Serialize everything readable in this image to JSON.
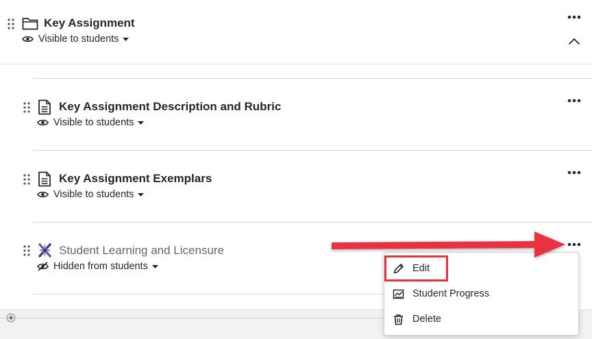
{
  "folder": {
    "title": "Key Assignment",
    "visibility": "Visible to students"
  },
  "items": [
    {
      "title": "Key Assignment Description and Rubric",
      "visibility": "Visible to students"
    },
    {
      "title": "Key Assignment Exemplars",
      "visibility": "Visible to students"
    },
    {
      "title": "Student Learning and Licensure",
      "visibility": "Hidden from students"
    }
  ],
  "menu": {
    "edit": "Edit",
    "progress": "Student Progress",
    "delete": "Delete"
  },
  "colors": {
    "highlight": "#e8333f",
    "arrow": "#e8333f",
    "divider": "#d6d6d6"
  },
  "icons": [
    "drag-handle-icon",
    "folder-icon",
    "document-icon",
    "lti-tool-icon",
    "eye-icon",
    "eye-slash-icon",
    "caret-down-icon",
    "more-icon",
    "chevron-up-icon",
    "pencil-icon",
    "progress-icon",
    "trash-icon",
    "add-icon"
  ]
}
